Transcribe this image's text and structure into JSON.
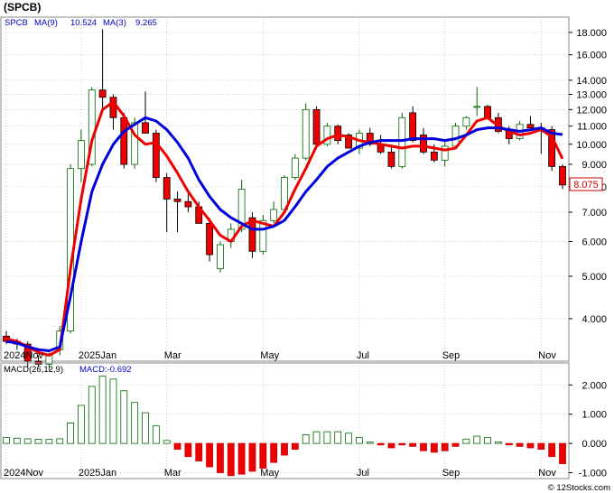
{
  "header": {
    "symbol": "(SPCB)"
  },
  "watermark": "© 12Stocks.com",
  "chart_data": [
    {
      "type": "candlestick",
      "legend": {
        "ticker": "SPCB",
        "ma_fast_label": "MA(9)",
        "ma_fast_value": "10.524",
        "ma_slow_label": "MA(3)",
        "ma_slow_value": "9.265"
      },
      "last_price_label": "8.075",
      "y_scale": "log",
      "ylim": [
        3.2,
        19.5
      ],
      "y_ticks": [
        {
          "v": 4,
          "label": "4.000"
        },
        {
          "v": 5,
          "label": "5.000"
        },
        {
          "v": 6,
          "label": "6.000"
        },
        {
          "v": 7,
          "label": "7.000"
        },
        {
          "v": 8,
          "label": "8.000"
        },
        {
          "v": 9,
          "label": "9.000"
        },
        {
          "v": 10,
          "label": "10.000"
        },
        {
          "v": 11,
          "label": "11.000"
        },
        {
          "v": 12,
          "label": "12.000"
        },
        {
          "v": 13,
          "label": "13.000"
        },
        {
          "v": 14,
          "label": "14.000"
        },
        {
          "v": 16,
          "label": "16.000"
        },
        {
          "v": 18,
          "label": "18.000"
        }
      ],
      "x_ticks": [
        {
          "i": 0,
          "label": "2024Nov"
        },
        {
          "i": 7,
          "label": "2025Jan"
        },
        {
          "i": 15,
          "label": "Mar"
        },
        {
          "i": 24,
          "label": "May"
        },
        {
          "i": 33,
          "label": "Jul"
        },
        {
          "i": 41,
          "label": "Sep"
        },
        {
          "i": 50,
          "label": "Nov"
        }
      ],
      "candles": [
        [
          3.65,
          3.75,
          3.5,
          3.55
        ],
        [
          3.55,
          3.6,
          3.4,
          3.5
        ],
        [
          3.5,
          3.55,
          3.1,
          3.2
        ],
        [
          3.2,
          3.3,
          3.1,
          3.15
        ],
        [
          3.15,
          3.35,
          3.05,
          3.3
        ],
        [
          3.4,
          3.85,
          3.3,
          3.75
        ],
        [
          3.75,
          9.0,
          3.7,
          8.8
        ],
        [
          8.8,
          10.8,
          8.2,
          10.2
        ],
        [
          9.0,
          13.5,
          8.9,
          13.3
        ],
        [
          13.3,
          18.3,
          11.8,
          12.8
        ],
        [
          12.8,
          13.0,
          10.8,
          11.5
        ],
        [
          11.5,
          11.8,
          8.8,
          9.0
        ],
        [
          9.0,
          11.5,
          8.8,
          11.2
        ],
        [
          11.2,
          13.2,
          10.8,
          10.6
        ],
        [
          10.6,
          10.8,
          8.2,
          8.4
        ],
        [
          8.4,
          8.6,
          6.3,
          7.5
        ],
        [
          7.5,
          7.8,
          6.3,
          7.4
        ],
        [
          7.4,
          7.8,
          7.0,
          7.2
        ],
        [
          7.2,
          7.4,
          6.9,
          6.6
        ],
        [
          6.6,
          6.8,
          5.4,
          5.6
        ],
        [
          5.2,
          6.0,
          5.1,
          5.9
        ],
        [
          6.0,
          6.6,
          5.8,
          6.4
        ],
        [
          6.4,
          8.3,
          6.3,
          7.9
        ],
        [
          6.8,
          7.0,
          5.5,
          5.7
        ],
        [
          5.7,
          6.9,
          5.6,
          6.7
        ],
        [
          6.7,
          7.4,
          6.6,
          7.1
        ],
        [
          7.1,
          8.5,
          7.0,
          8.4
        ],
        [
          8.4,
          9.5,
          8.3,
          9.3
        ],
        [
          9.3,
          12.4,
          9.2,
          12.0
        ],
        [
          12.0,
          12.2,
          9.8,
          10.0
        ],
        [
          10.0,
          11.2,
          9.9,
          11.0
        ],
        [
          11.0,
          11.1,
          10.0,
          10.2
        ],
        [
          10.5,
          10.6,
          9.8,
          9.8
        ],
        [
          9.8,
          10.8,
          9.5,
          10.6
        ],
        [
          10.6,
          10.9,
          9.9,
          10.0
        ],
        [
          10.0,
          10.5,
          9.5,
          9.6
        ],
        [
          9.6,
          10.0,
          8.8,
          8.9
        ],
        [
          8.9,
          11.8,
          8.8,
          11.5
        ],
        [
          11.8,
          12.2,
          10.1,
          10.2
        ],
        [
          10.5,
          10.9,
          9.5,
          9.6
        ],
        [
          9.6,
          10.0,
          9.1,
          9.2
        ],
        [
          9.2,
          10.2,
          8.9,
          9.9
        ],
        [
          9.9,
          11.2,
          9.8,
          11.0
        ],
        [
          11.0,
          11.6,
          10.8,
          11.5
        ],
        [
          12.2,
          13.5,
          11.6,
          12.2
        ],
        [
          12.2,
          12.3,
          11.4,
          11.5
        ],
        [
          11.5,
          11.8,
          10.6,
          10.7
        ],
        [
          10.7,
          11.0,
          10.0,
          10.3
        ],
        [
          10.3,
          11.3,
          10.2,
          11.1
        ],
        [
          11.1,
          11.6,
          10.7,
          10.9
        ],
        [
          10.9,
          11.2,
          9.5,
          10.8
        ],
        [
          10.8,
          11.0,
          8.7,
          8.9
        ],
        [
          8.9,
          9.0,
          7.9,
          8.075
        ]
      ],
      "ma_fast": [
        3.55,
        3.52,
        3.45,
        3.4,
        3.38,
        3.45,
        4.5,
        6.0,
        7.8,
        9.0,
        10.0,
        10.7,
        11.1,
        11.5,
        11.3,
        10.8,
        10.1,
        9.3,
        8.3,
        7.6,
        7.1,
        6.8,
        6.6,
        6.4,
        6.4,
        6.5,
        6.7,
        7.2,
        7.8,
        8.3,
        8.9,
        9.3,
        9.6,
        9.9,
        10.1,
        10.2,
        10.2,
        10.2,
        10.3,
        10.3,
        10.3,
        10.2,
        10.3,
        10.5,
        10.8,
        10.9,
        10.9,
        10.8,
        10.7,
        10.8,
        10.9,
        10.6,
        10.524
      ],
      "ma_slow": [
        3.6,
        3.55,
        3.45,
        3.35,
        3.3,
        3.4,
        5.2,
        7.5,
        10.2,
        12.0,
        12.5,
        11.6,
        10.5,
        10.0,
        10.1,
        9.4,
        8.6,
        7.8,
        7.2,
        6.7,
        6.2,
        6.0,
        6.5,
        6.7,
        6.6,
        6.5,
        7.0,
        7.9,
        8.8,
        9.9,
        10.3,
        10.5,
        10.4,
        10.2,
        10.1,
        10.0,
        9.9,
        9.8,
        9.9,
        9.9,
        9.8,
        9.7,
        9.8,
        10.5,
        11.3,
        11.5,
        11.0,
        10.7,
        10.5,
        10.6,
        10.8,
        10.4,
        9.265
      ]
    },
    {
      "type": "bar",
      "legend": {
        "label": "MACD(26,12,9)",
        "value_label": "MACD:-0.692"
      },
      "ylim": [
        -1.2,
        2.75
      ],
      "y_ticks": [
        {
          "v": 2,
          "label": "2.000"
        },
        {
          "v": 1,
          "label": "1.000"
        },
        {
          "v": 0,
          "label": "0.000"
        },
        {
          "v": -1,
          "label": "-1.000"
        }
      ],
      "x_ticks": [
        {
          "i": 0,
          "label": "2024Nov"
        },
        {
          "i": 7,
          "label": "2025Jan"
        },
        {
          "i": 15,
          "label": "Mar"
        },
        {
          "i": 24,
          "label": "May"
        },
        {
          "i": 33,
          "label": "Jul"
        },
        {
          "i": 41,
          "label": "Sep"
        },
        {
          "i": 50,
          "label": "Nov"
        }
      ],
      "values": [
        0.2,
        0.18,
        0.16,
        0.14,
        0.14,
        0.16,
        0.7,
        1.3,
        1.95,
        2.3,
        2.2,
        1.8,
        1.4,
        1.05,
        0.6,
        0.1,
        -0.2,
        -0.45,
        -0.6,
        -0.8,
        -1.0,
        -1.1,
        -1.05,
        -0.95,
        -0.85,
        -0.65,
        -0.4,
        -0.2,
        0.3,
        0.4,
        0.4,
        0.4,
        0.35,
        0.2,
        0.05,
        -0.05,
        -0.15,
        -0.05,
        -0.1,
        -0.25,
        -0.3,
        -0.25,
        -0.1,
        0.15,
        0.25,
        0.2,
        0.05,
        -0.05,
        -0.1,
        -0.15,
        -0.2,
        -0.45,
        -0.692
      ]
    }
  ]
}
